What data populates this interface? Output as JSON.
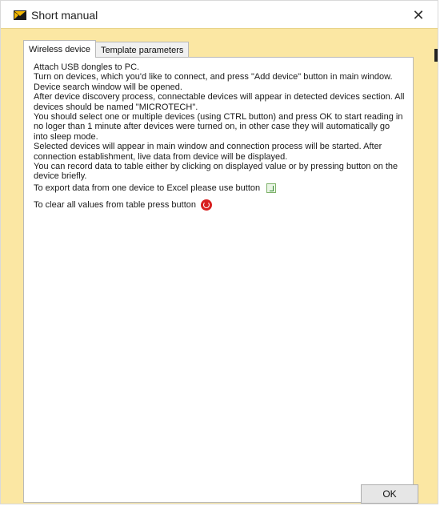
{
  "window": {
    "title": "Short manual",
    "close_symbol": "✕",
    "app_icon": "envelope-logo-icon"
  },
  "tabs": [
    {
      "label": "Wireless device",
      "active": true
    },
    {
      "label": "Template parameters",
      "active": false
    }
  ],
  "manual": {
    "lines": [
      "Attach USB dongles to PC.",
      "Turn on devices, which you'd like to connect, and press \"Add device\" button in main window. Device search window will be opened.",
      "After device discovery process, connectable devices will appear in detected devices section. All devices should be named \"MICROTECH\".",
      "You should select one or multiple devices (using CTRL button) and press OK to start reading in no loger than 1 minute after devices were turned on, in other case they will automatically go into sleep mode.",
      "Selected devices will appear in main window and connection process will be started. After connection establishment, live data from device will be displayed.",
      "You can record data to table either by clicking on displayed value or by pressing button on the device briefly."
    ],
    "export_text": "To export data from one device to Excel please use button",
    "clear_text": "To clear all values from table press button"
  },
  "footer": {
    "ok_label": "OK"
  },
  "colors": {
    "dialog_background": "#fbe7a3",
    "panel_background": "#ffffff",
    "excel_icon": "#2f8a2f",
    "clear_icon": "#d81f1f"
  }
}
